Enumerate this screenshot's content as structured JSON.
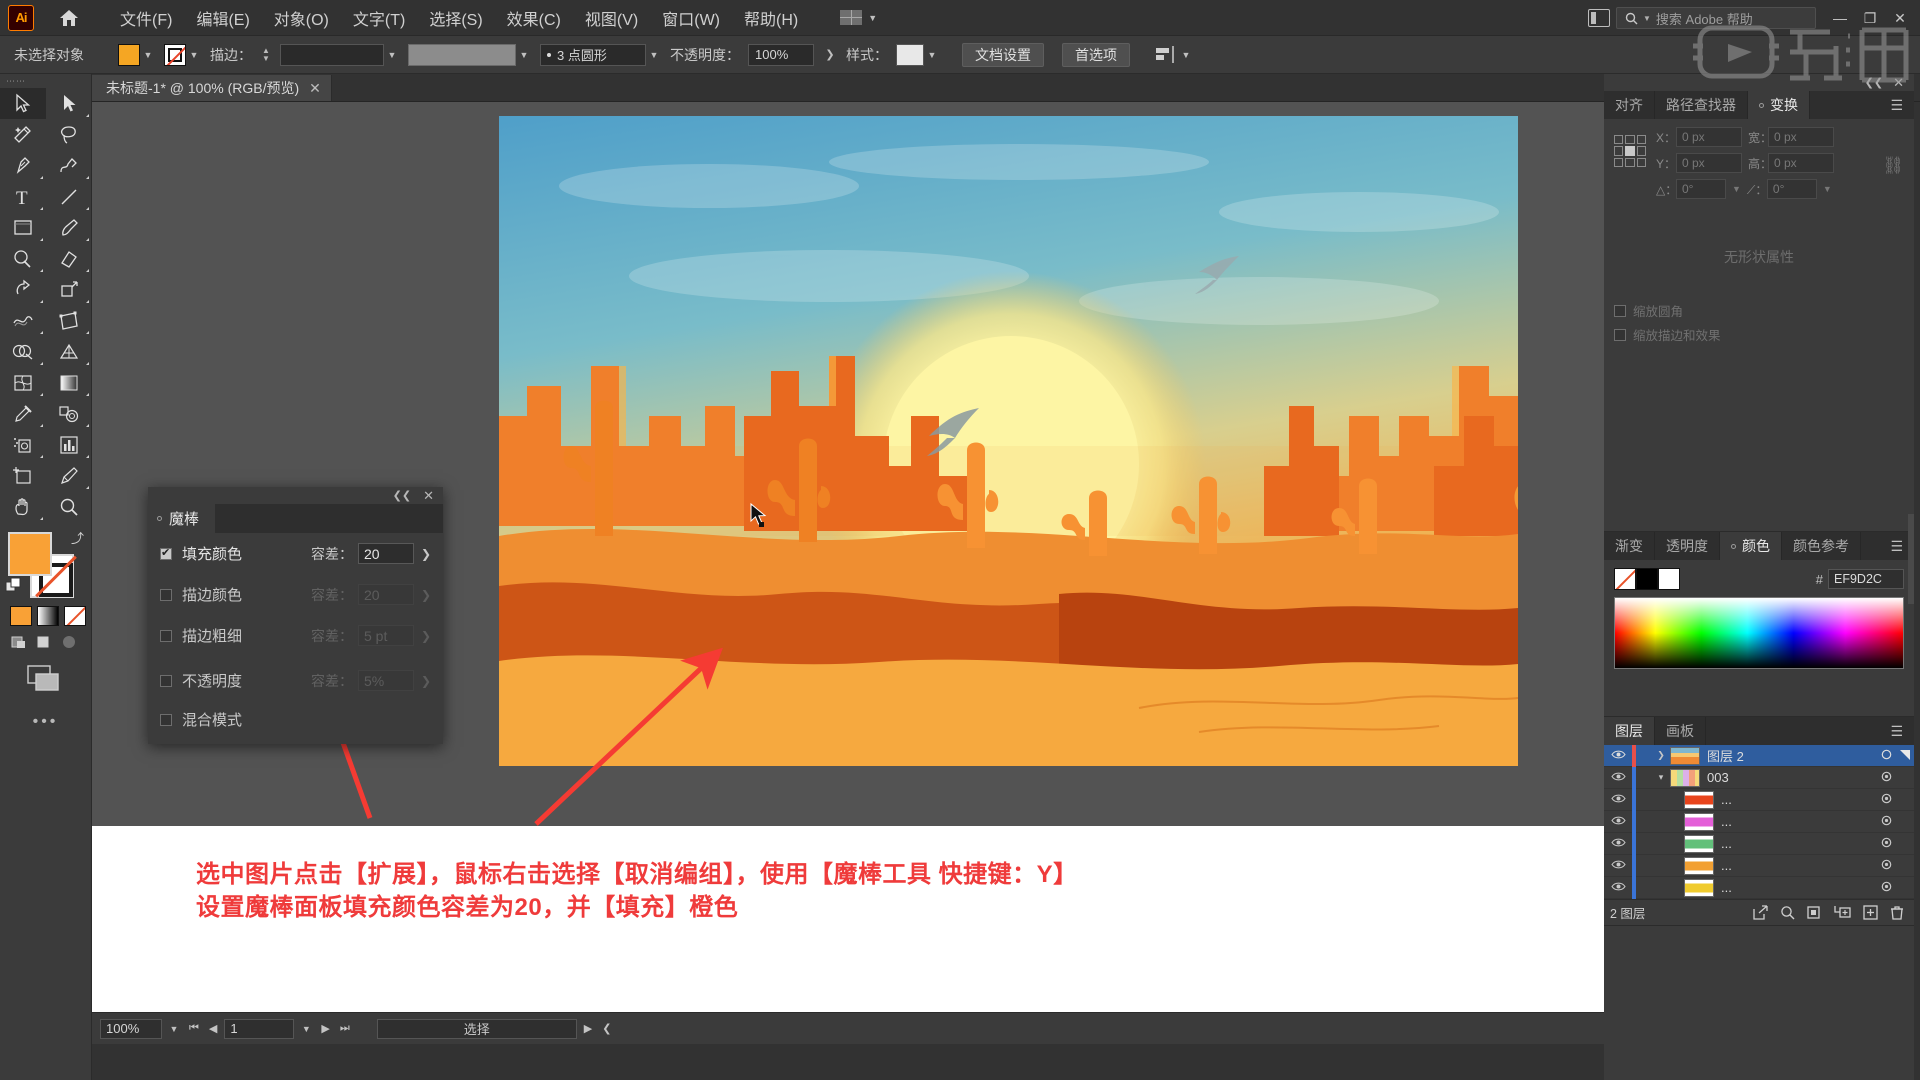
{
  "app": {
    "name": "Adobe Illustrator",
    "logo_text": "Ai"
  },
  "menubar": {
    "items": [
      {
        "label": "文件(F)",
        "name": "menu-file"
      },
      {
        "label": "编辑(E)",
        "name": "menu-edit"
      },
      {
        "label": "对象(O)",
        "name": "menu-object"
      },
      {
        "label": "文字(T)",
        "name": "menu-type"
      },
      {
        "label": "选择(S)",
        "name": "menu-select"
      },
      {
        "label": "效果(C)",
        "name": "menu-effect"
      },
      {
        "label": "视图(V)",
        "name": "menu-view"
      },
      {
        "label": "窗口(W)",
        "name": "menu-window"
      },
      {
        "label": "帮助(H)",
        "name": "menu-help"
      }
    ],
    "search_placeholder": "搜索 Adobe 帮助",
    "window_buttons": {
      "minimize": "—",
      "restore": "❐",
      "close": "✕"
    },
    "watermark": "虎课网"
  },
  "controlbar": {
    "selection_status": "未选择对象",
    "fill_color": "#F5A623",
    "stroke_label": "描边：",
    "stroke_weight": "",
    "stroke_profile": "3 点圆形",
    "opacity_label": "不透明度：",
    "opacity_value": "100%",
    "style_label": "样式：",
    "document_setup": "文档设置",
    "preferences": "首选项"
  },
  "toolbar": {
    "tools": [
      {
        "name": "selection-tool",
        "label": "选择工具",
        "active": true
      },
      {
        "name": "direct-selection-tool",
        "label": "直接选择工具",
        "active": false
      },
      {
        "name": "magic-wand-tool",
        "label": "魔棒工具",
        "active": false
      },
      {
        "name": "lasso-tool",
        "label": "套索工具",
        "active": false
      },
      {
        "name": "pen-tool",
        "label": "钢笔工具",
        "active": false
      },
      {
        "name": "curvature-tool",
        "label": "曲率工具",
        "active": false
      },
      {
        "name": "type-tool",
        "label": "文字工具",
        "active": false
      },
      {
        "name": "line-segment-tool",
        "label": "直线段工具",
        "active": false
      },
      {
        "name": "rectangle-tool",
        "label": "矩形工具",
        "active": false
      },
      {
        "name": "paintbrush-tool",
        "label": "画笔工具",
        "active": false
      },
      {
        "name": "shaper-tool",
        "label": "Shaper 工具",
        "active": false
      },
      {
        "name": "eraser-tool",
        "label": "橡皮擦工具",
        "active": false
      },
      {
        "name": "rotate-tool",
        "label": "旋转工具",
        "active": false
      },
      {
        "name": "scale-tool",
        "label": "比例缩放工具",
        "active": false
      },
      {
        "name": "width-tool",
        "label": "宽度工具",
        "active": false
      },
      {
        "name": "free-transform-tool",
        "label": "自由变换工具",
        "active": false
      },
      {
        "name": "shape-builder-tool",
        "label": "形状生成器工具",
        "active": false
      },
      {
        "name": "perspective-grid-tool",
        "label": "透视网格工具",
        "active": false
      },
      {
        "name": "mesh-tool",
        "label": "网格工具",
        "active": false
      },
      {
        "name": "gradient-tool",
        "label": "渐变工具",
        "active": false
      },
      {
        "name": "eyedropper-tool",
        "label": "吸管工具",
        "active": false
      },
      {
        "name": "blend-tool",
        "label": "混合工具",
        "active": false
      },
      {
        "name": "symbol-sprayer-tool",
        "label": "符号喷枪工具",
        "active": false
      },
      {
        "name": "column-graph-tool",
        "label": "柱形图工具",
        "active": false
      },
      {
        "name": "artboard-tool",
        "label": "画板工具",
        "active": false
      },
      {
        "name": "slice-tool",
        "label": "切片工具",
        "active": false
      },
      {
        "name": "hand-tool",
        "label": "抓手工具",
        "active": false
      },
      {
        "name": "zoom-tool",
        "label": "缩放工具",
        "active": false
      }
    ],
    "fill_color": "#F9A136",
    "stroke_color": "#FFFFFF",
    "more_tools": "•••"
  },
  "document_tab": {
    "title": "未标题-1* @ 100% (RGB/预览)",
    "close": "✕"
  },
  "magic_wand_panel": {
    "tab_label": "魔棒",
    "close": "✕",
    "collapse": "❮❮",
    "rows": [
      {
        "name": "fill-color",
        "label": "填充颜色",
        "checked": true,
        "tolerance_label": "容差：",
        "tolerance_value": "20",
        "enabled": true
      },
      {
        "name": "stroke-color",
        "label": "描边颜色",
        "checked": false,
        "tolerance_label": "容差：",
        "tolerance_value": "20",
        "enabled": false
      },
      {
        "name": "stroke-weight",
        "label": "描边粗细",
        "checked": false,
        "tolerance_label": "容差：",
        "tolerance_value": "5 pt",
        "enabled": false
      },
      {
        "name": "opacity",
        "label": "不透明度",
        "checked": false,
        "tolerance_label": "容差：",
        "tolerance_value": "5%",
        "enabled": false
      },
      {
        "name": "blending-mode",
        "label": "混合模式",
        "checked": false,
        "tolerance_label": "",
        "tolerance_value": "",
        "enabled": false
      }
    ]
  },
  "transform_panel": {
    "titlebar": {
      "collapse": "❮❮",
      "close": "✕"
    },
    "tabs": [
      {
        "label": "对齐",
        "name": "tab-align",
        "active": false
      },
      {
        "label": "路径查找器",
        "name": "tab-pathfinder",
        "active": false
      },
      {
        "label": "变换",
        "name": "tab-transform",
        "active": true
      }
    ],
    "menu_icon": "☰",
    "fields": {
      "x_label": "X：",
      "x_value": "0 px",
      "y_label": "Y：",
      "y_value": "0 px",
      "w_label": "宽：",
      "w_value": "0 px",
      "h_label": "高：",
      "h_value": "0 px",
      "angle_label": "△：",
      "angle_value": "0°",
      "shear_label": "⟋：",
      "shear_value": "0°"
    },
    "checkboxes": [
      {
        "label": "缩放圆角",
        "name": "scale-corners",
        "checked": false
      },
      {
        "label": "缩放描边和效果",
        "name": "scale-strokes-effects",
        "checked": false
      }
    ],
    "empty_text": "无形状属性"
  },
  "color_panel": {
    "tabs": [
      {
        "label": "渐变",
        "name": "tab-gradient",
        "active": false
      },
      {
        "label": "透明度",
        "name": "tab-transparency",
        "active": false
      },
      {
        "label": "颜色",
        "name": "tab-color",
        "active": true
      },
      {
        "label": "颜色参考",
        "name": "tab-color-guide",
        "active": false
      }
    ],
    "menu_icon": "☰",
    "hex_prefix": "#",
    "hex_value": "EF9D2C"
  },
  "layers_panel": {
    "tabs": [
      {
        "label": "图层",
        "name": "tab-layers",
        "active": true
      },
      {
        "label": "画板",
        "name": "tab-artboards",
        "active": false
      }
    ],
    "menu_icon": "☰",
    "rows": [
      {
        "name": "图层 2",
        "selected": true,
        "expandable": true,
        "expanded": false,
        "color": "#e8504a",
        "thumb": "artwork",
        "indent": 0
      },
      {
        "name": "003",
        "selected": false,
        "expandable": true,
        "expanded": true,
        "color": "#3a74d8",
        "thumb": "group",
        "indent": 1
      },
      {
        "name": "...",
        "selected": false,
        "expandable": false,
        "expanded": false,
        "color": "#3a74d8",
        "thumb": "red",
        "indent": 2
      },
      {
        "name": "...",
        "selected": false,
        "expandable": false,
        "expanded": false,
        "color": "#3a74d8",
        "thumb": "magenta",
        "indent": 2
      },
      {
        "name": "...",
        "selected": false,
        "expandable": false,
        "expanded": false,
        "color": "#3a74d8",
        "thumb": "green",
        "indent": 2
      },
      {
        "name": "...",
        "selected": false,
        "expandable": false,
        "expanded": false,
        "color": "#3a74d8",
        "thumb": "orange",
        "indent": 2
      },
      {
        "name": "...",
        "selected": false,
        "expandable": false,
        "expanded": false,
        "color": "#3a74d8",
        "thumb": "yellow",
        "indent": 2
      }
    ],
    "footer": {
      "count_label": "2 图层",
      "icons": [
        "locate-object-icon",
        "search-icon",
        "make-clipping-mask-icon",
        "create-sublayer-icon",
        "create-new-layer-icon",
        "delete-layer-icon"
      ]
    }
  },
  "statusbar": {
    "zoom": "100%",
    "page": "1",
    "status_text": "选择",
    "nav_first": "⏮",
    "nav_prev": "◀",
    "nav_next": "▶",
    "nav_last": "⏭"
  },
  "annotation": {
    "line1": "选中图片点击【扩展】，鼠标右击选择【取消编组】，使用【魔棒工具 快捷键：Y】",
    "line2": "设置魔棒面板填充颜色容差为20，并【填充】橙色",
    "color": "#EF3B3B"
  },
  "artwork": {
    "description": "沙漠日落插画 — 仙人掌、岩石、飞鸟、太阳",
    "sun_color": "#FBF3A0",
    "sky_top": "#58A6CE",
    "sand_color": "#F5A33C",
    "cactus_color": "#F08A2E"
  }
}
